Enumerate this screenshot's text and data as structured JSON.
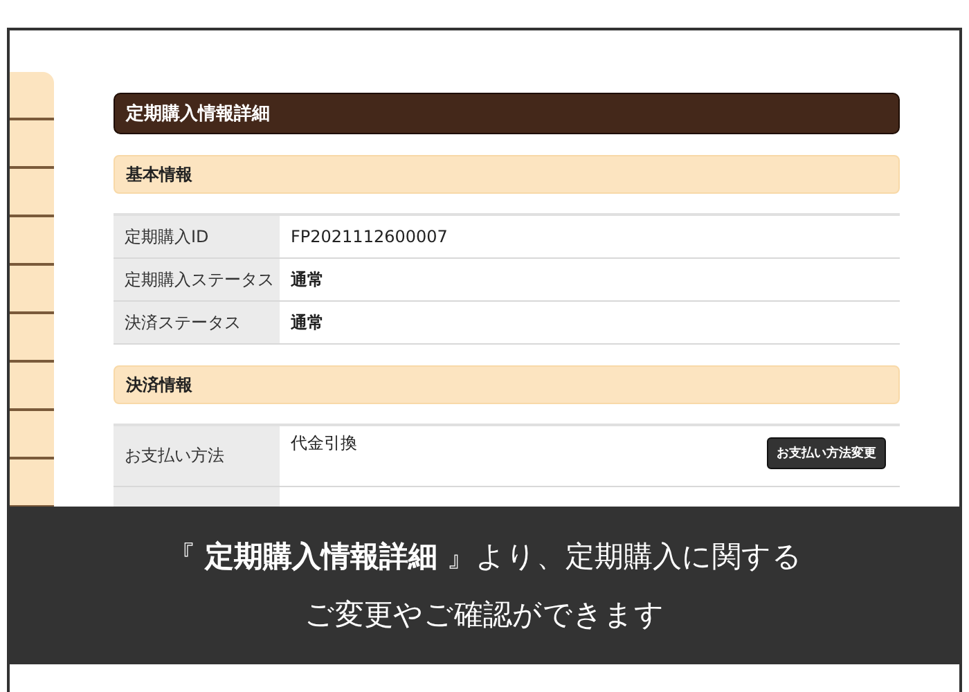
{
  "page_title": "定期購入情報詳細",
  "sections": [
    {
      "title": "基本情報",
      "rows": [
        {
          "label": "定期購入ID",
          "value": "FP2021112600007",
          "bold": false
        },
        {
          "label": "定期購入ステータス",
          "value": "通常",
          "bold": true
        },
        {
          "label": "決済ステータス",
          "value": "通常",
          "bold": true
        }
      ]
    },
    {
      "title": "決済情報",
      "rows": [
        {
          "label": "お支払い方法",
          "value": "代金引換",
          "bold": false,
          "button": "お支払い方法変更"
        }
      ]
    }
  ],
  "caption": {
    "lines": [
      "『 **定期購入情報詳細** 』より、定期購入に関する",
      "ご変更やご確認ができます"
    ]
  }
}
